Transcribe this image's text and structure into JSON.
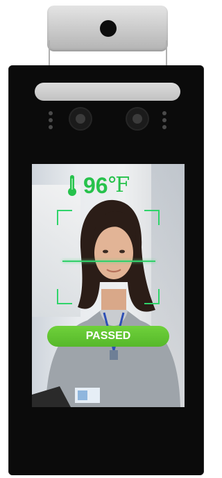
{
  "screen": {
    "temperature": "96",
    "unit": "℉",
    "status_label": "PASSED"
  },
  "icons": {
    "thermometer": "thermometer-icon"
  },
  "colors": {
    "reading": "#27c24c",
    "scan_frame": "#2fd46a",
    "passed_banner": "#5cbf2f",
    "device_body": "#0b0b0b",
    "sensor_head": "#c9c9c9"
  }
}
